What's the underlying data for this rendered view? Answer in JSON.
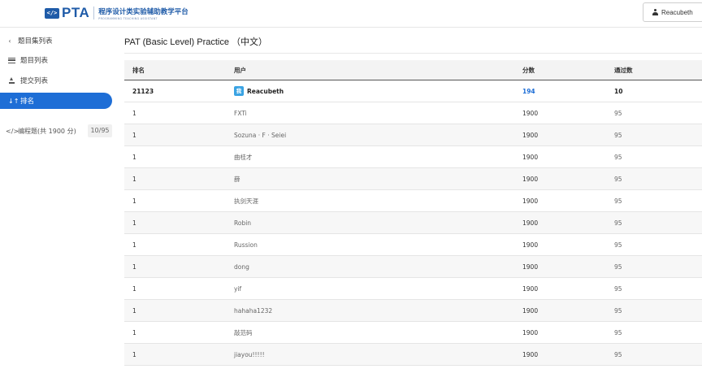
{
  "header": {
    "logo_mark": "</>",
    "logo_text": "PTA",
    "logo_cn": "程序设计类实验辅助教学平台",
    "logo_en": "PROGRAMMING TEACHING ASSISTANT",
    "user_button": "Reacubeth",
    "user_icon": "user-icon"
  },
  "sidebar": {
    "back": {
      "icon": "chevron-left-icon",
      "label": "题目集列表"
    },
    "items": [
      {
        "icon": "list-icon",
        "label": "题目列表"
      },
      {
        "icon": "upload-icon",
        "label": "提交列表"
      },
      {
        "icon": "sort-icon",
        "label": "排名"
      }
    ],
    "group": {
      "icon": "code-icon",
      "label": "编程题(共 1900 分)",
      "badge": "10/95"
    },
    "active_color": "#1e6ed6"
  },
  "main": {
    "title": "PAT (Basic Level) Practice （中文）",
    "columns": [
      "排名",
      "用户",
      "分数",
      "通过数"
    ],
    "me_row": {
      "rank": "21123",
      "badge": "我",
      "user": "Reacubeth",
      "score": "194",
      "passed": "10"
    },
    "rows": [
      {
        "rank": "1",
        "user": "FXTi",
        "score": "1900",
        "passed": "95"
      },
      {
        "rank": "1",
        "user": "Sozuna · F · Seiei",
        "score": "1900",
        "passed": "95"
      },
      {
        "rank": "1",
        "user": "曲桂才",
        "score": "1900",
        "passed": "95"
      },
      {
        "rank": "1",
        "user": "薛",
        "score": "1900",
        "passed": "95"
      },
      {
        "rank": "1",
        "user": "执剑天涯",
        "score": "1900",
        "passed": "95"
      },
      {
        "rank": "1",
        "user": "Robin",
        "score": "1900",
        "passed": "95"
      },
      {
        "rank": "1",
        "user": "Russion",
        "score": "1900",
        "passed": "95"
      },
      {
        "rank": "1",
        "user": "dong",
        "score": "1900",
        "passed": "95"
      },
      {
        "rank": "1",
        "user": "yif",
        "score": "1900",
        "passed": "95"
      },
      {
        "rank": "1",
        "user": "hahaha1232",
        "score": "1900",
        "passed": "95"
      },
      {
        "rank": "1",
        "user": "敲范码",
        "score": "1900",
        "passed": "95"
      },
      {
        "rank": "1",
        "user": "jiayou!!!!!",
        "score": "1900",
        "passed": "95"
      }
    ]
  }
}
